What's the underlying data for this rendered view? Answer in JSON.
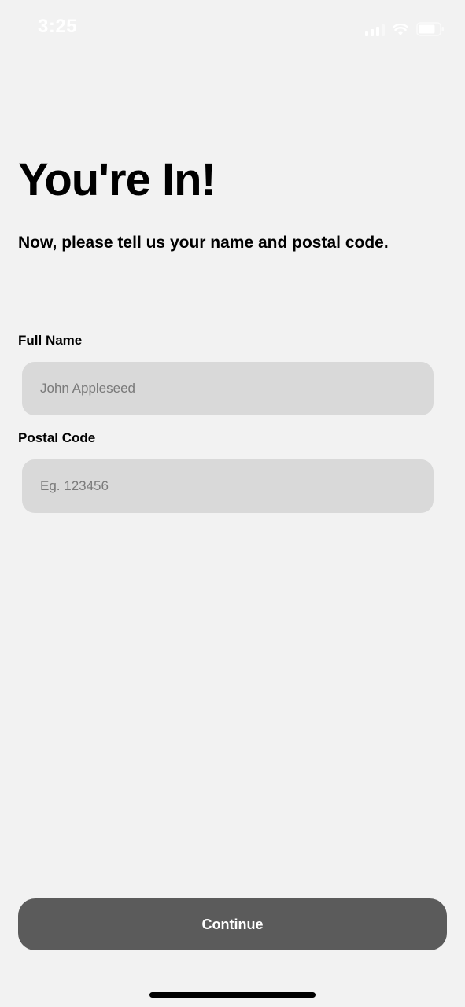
{
  "status_bar": {
    "time": "3:25",
    "icons": [
      "cellular-signal-icon",
      "wifi-icon",
      "battery-icon"
    ]
  },
  "page": {
    "title": "You're In!",
    "subtitle": "Now, please tell us your name and postal code."
  },
  "form": {
    "full_name": {
      "label": "Full Name",
      "value": "",
      "placeholder": "John Appleseed"
    },
    "postal_code": {
      "label": "Postal Code",
      "value": "",
      "placeholder": "Eg. 123456"
    }
  },
  "actions": {
    "continue_label": "Continue"
  },
  "colors": {
    "background": "#f2f2f2",
    "input_background": "#d9d9d9",
    "button_background": "#5b5b5b",
    "button_text": "#ffffff"
  }
}
